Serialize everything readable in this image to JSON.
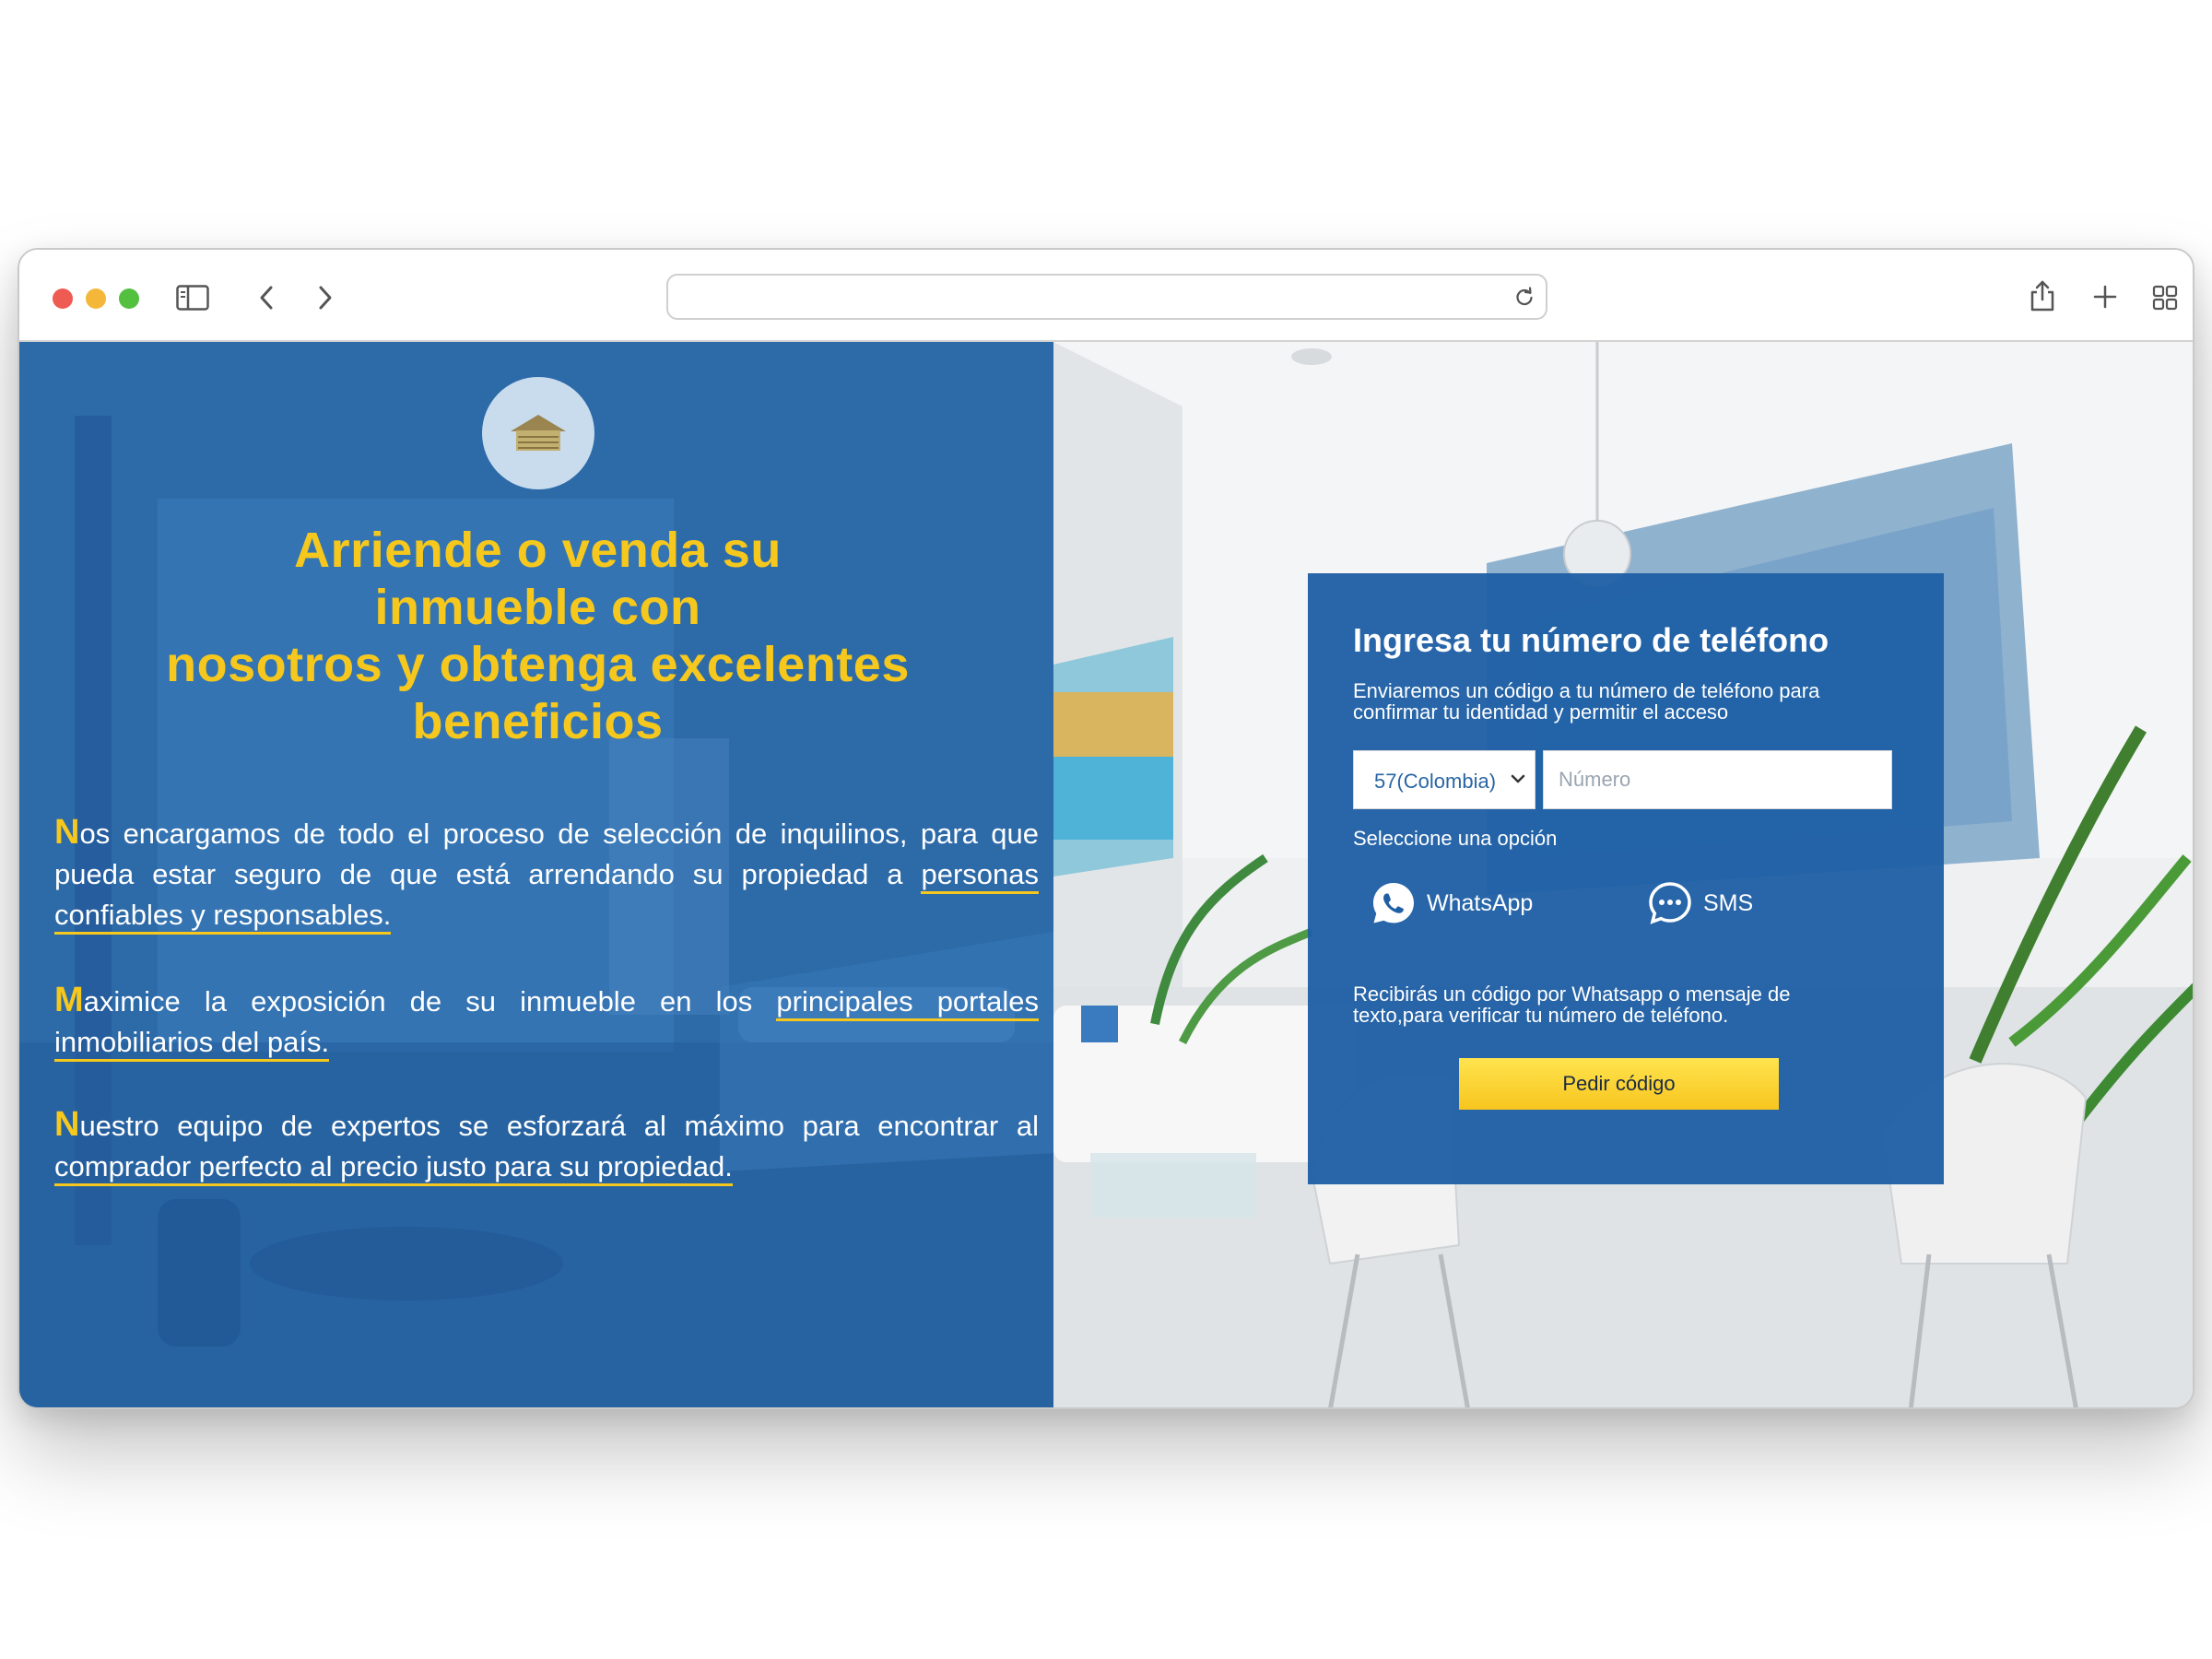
{
  "browser": {
    "traffic_lights": {
      "close_color": "#ee5b52",
      "minimize_color": "#f4b73a",
      "zoom_color": "#53c040"
    },
    "url_text": "",
    "icons": [
      "sidebar-icon",
      "back-icon",
      "forward-icon",
      "reload-icon",
      "share-icon",
      "new-tab-icon",
      "tab-overview-icon"
    ]
  },
  "hero": {
    "logo_icon": "house-icon",
    "headline_lines": [
      "Arriende o venda su",
      "inmueble con",
      "nosotros y obtenga excelentes",
      "beneficios"
    ],
    "p1": {
      "first_letter": "N",
      "text": "os encargamos de todo el proceso de selección de inquilinos, para que pueda estar seguro de que está arrendando su propiedad a ",
      "highlight": "personas confiables y responsables."
    },
    "p2": {
      "first_letter": "M",
      "text": "aximice la exposición de su inmueble en los ",
      "highlight": "principales portales inmobiliarios del país."
    },
    "p3": {
      "first_letter": "N",
      "text": "uestro equipo de expertos se esforzará al máximo para encontrar al ",
      "highlight": "comprador perfecto al precio justo para su propiedad."
    }
  },
  "form": {
    "title": "Ingresa tu número de teléfono",
    "subtitle": "Enviaremos un código a tu número de teléfono para confirmar tu identidad y permitir el acceso",
    "country_selected": "57(Colombia)",
    "number_placeholder": "Número",
    "number_value": "",
    "option_label": "Seleccione una opción",
    "options": [
      {
        "label": "WhatsApp",
        "icon": "whatsapp-icon"
      },
      {
        "label": "SMS",
        "icon": "sms-chat-icon"
      }
    ],
    "note": "Recibirás un código por Whatsapp o mensaje de texto,para verificar tu número de teléfono.",
    "submit_label": "Pedir código"
  },
  "colors": {
    "brand_blue": "#2a66a4",
    "card_blue": "#1f60a5",
    "accent_yellow": "#f6c81d",
    "button_yellow": "#ffe44f"
  }
}
